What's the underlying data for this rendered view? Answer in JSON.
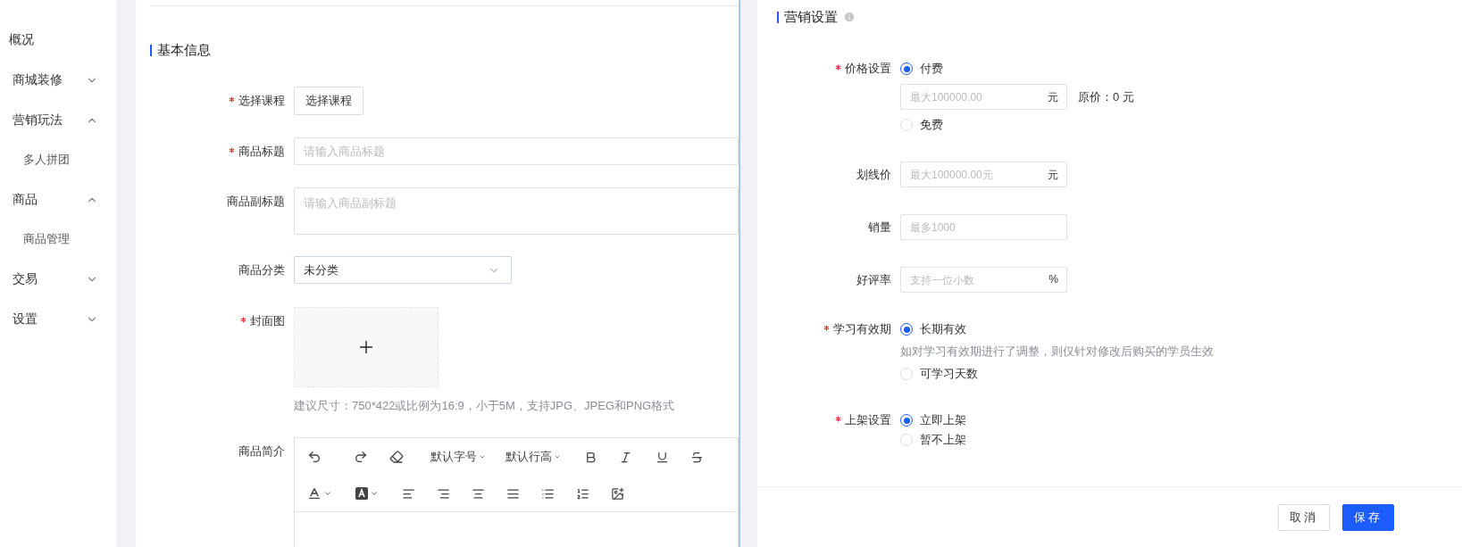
{
  "sidebar": {
    "items": [
      {
        "label": "概况"
      },
      {
        "label": "商城装修",
        "expanded": false
      },
      {
        "label": "营销玩法",
        "expanded": true,
        "children": [
          {
            "label": "多人拼团"
          }
        ]
      },
      {
        "label": "商品",
        "expanded": true,
        "children": [
          {
            "label": "商品管理"
          }
        ]
      },
      {
        "label": "交易",
        "expanded": false
      },
      {
        "label": "设置",
        "expanded": false
      }
    ]
  },
  "basic_info": {
    "title": "基本信息",
    "fields": [
      {
        "kind": "button",
        "label": "选择课程",
        "required": true,
        "button": "选择课程"
      },
      {
        "kind": "input",
        "label": "商品标题",
        "required": true,
        "placeholder": "请输入商品标题"
      },
      {
        "kind": "textarea",
        "label": "商品副标题",
        "required": false,
        "placeholder": "请输入商品副标题"
      },
      {
        "kind": "select",
        "label": "商品分类",
        "required": false,
        "value": "未分类"
      },
      {
        "kind": "upload",
        "label": "封面图",
        "required": true,
        "hint": "建议尺寸：750*422或比例为16:9，小于5M，支持JPG、JPEG和PNG格式"
      },
      {
        "kind": "editor",
        "label": "商品简介",
        "required": false,
        "font_size": "默认字号",
        "line_height": "默认行高"
      }
    ]
  },
  "marketing": {
    "title": "营销设置",
    "fields": [
      {
        "kind": "radio",
        "label": "价格设置",
        "required": true,
        "options": [
          {
            "label": "付费",
            "selected": true,
            "input": {
              "placeholder": "最大100000.00",
              "suffix": "元"
            },
            "note": "原价：0 元"
          },
          {
            "label": "免费",
            "selected": false
          }
        ]
      },
      {
        "kind": "input",
        "label": "划线价",
        "required": false,
        "placeholder": "最大100000.00元",
        "suffix": "元"
      },
      {
        "kind": "input",
        "label": "销量",
        "required": false,
        "placeholder": "最多1000"
      },
      {
        "kind": "input",
        "label": "好评率",
        "required": false,
        "placeholder": "支持一位小数",
        "suffix": "%"
      },
      {
        "kind": "radio",
        "label": "学习有效期",
        "required": true,
        "options": [
          {
            "label": "长期有效",
            "selected": true,
            "hint": "如对学习有效期进行了调整，则仅针对修改后购买的学员生效"
          },
          {
            "label": "可学习天数",
            "selected": false
          }
        ]
      },
      {
        "kind": "radio",
        "label": "上架设置",
        "required": true,
        "options": [
          {
            "label": "立即上架",
            "selected": true
          },
          {
            "label": "暂不上架",
            "selected": false
          }
        ]
      }
    ]
  },
  "footer": {
    "buttons": [
      {
        "label": "取消",
        "kind": "default"
      },
      {
        "label": "保存",
        "kind": "primary"
      }
    ]
  }
}
